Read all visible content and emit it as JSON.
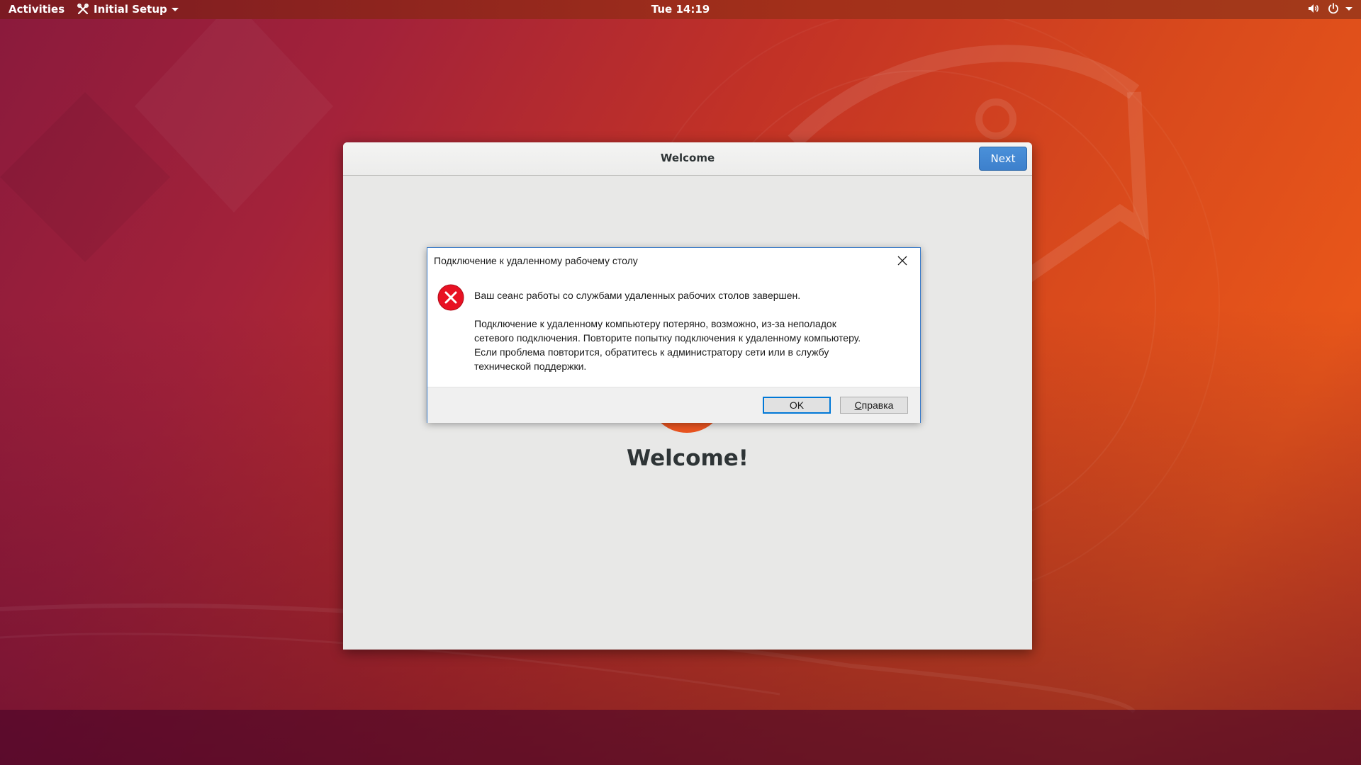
{
  "topbar": {
    "activities_label": "Activities",
    "app_menu_label": "Initial Setup",
    "clock": "Tue 14:19",
    "icons": [
      "settings-tool-icon",
      "volume-icon",
      "power-icon",
      "chevron-down-icon"
    ]
  },
  "setup_window": {
    "title": "Welcome",
    "next_label": "Next",
    "heading": "Welcome!",
    "accent_color": "#e95420",
    "next_button_color": "#3d80cc"
  },
  "rdp_dialog": {
    "title": "Подключение к удаленному рабочему столу",
    "message": "Ваш сеанс работы со службами удаленных рабочих столов завершен.",
    "detail_lines": [
      "Подключение к удаленному компьютеру потеряно, возможно, из-за неполадок",
      "сетевого подключения. Повторите попытку подключения к удаленному компьютеру.",
      "Если проблема повторится, обратитесь к администратору сети или в службу",
      "технической поддержки."
    ],
    "ok_label": "OK",
    "help_label_first": "С",
    "help_label_rest": "правка",
    "error_color": "#e81123",
    "border_color": "#3a7bc8"
  }
}
